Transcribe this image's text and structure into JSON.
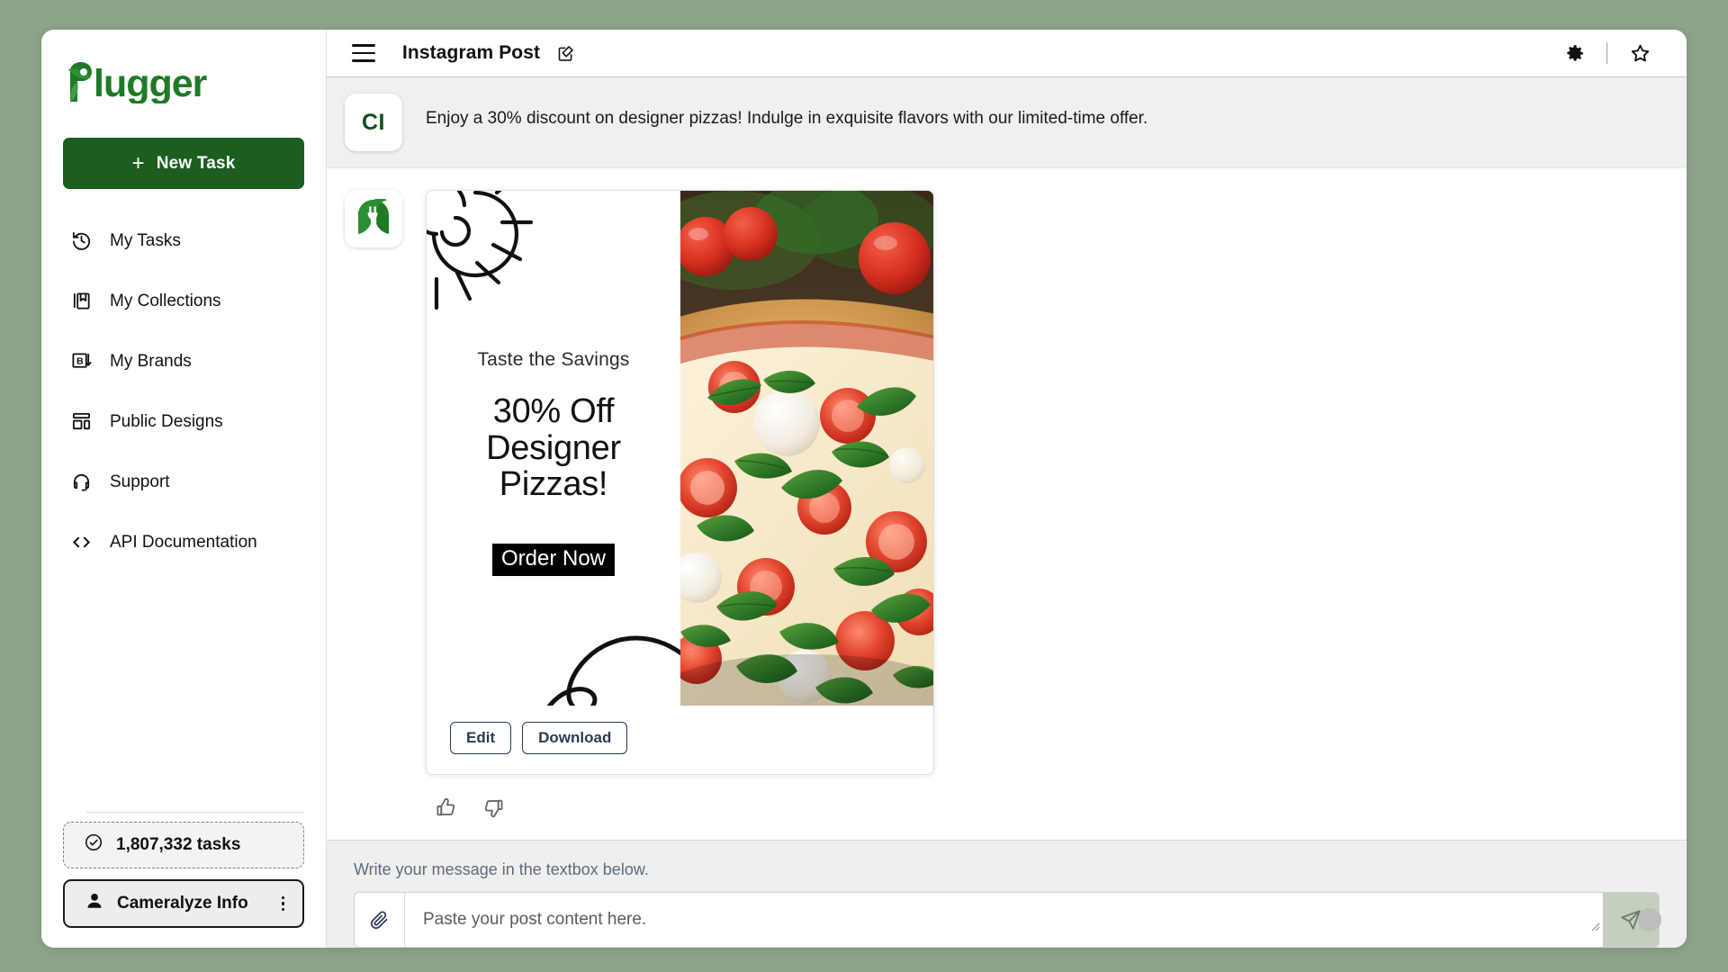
{
  "theme": {
    "page_background": "#8ba387",
    "brand_green": "#1b5e20",
    "accent_button": "#2b3a55",
    "send_button_bg": "#c3cfbf"
  },
  "sidebar": {
    "logo_text": "plugger",
    "new_task_label": "New Task",
    "new_task_plus": "+",
    "items": [
      {
        "label": "My Tasks",
        "icon": "history-icon"
      },
      {
        "label": "My Collections",
        "icon": "collections-icon"
      },
      {
        "label": "My Brands",
        "icon": "brand-box-icon"
      },
      {
        "label": "Public Designs",
        "icon": "layout-grid-icon"
      },
      {
        "label": "Support",
        "icon": "headset-icon"
      },
      {
        "label": "API Documentation",
        "icon": "code-brackets-icon"
      }
    ],
    "footer": {
      "tasks_count_label": "1,807,332 tasks",
      "account_name": "Cameralyze Info"
    }
  },
  "topbar": {
    "title": "Instagram Post",
    "menu_icon": "hamburger-icon",
    "edit_icon": "edit-square-icon",
    "settings_icon": "gear-icon",
    "favorite_icon": "star-outline-icon"
  },
  "conversation": {
    "user_message": {
      "avatar_initials": "CI",
      "text": "Enjoy a 30% discount on designer pizzas! Indulge in exquisite flavors with our limited-time offer."
    },
    "assistant_message": {
      "avatar_icon": "plugger-logo-mark",
      "design": {
        "kicker": "Taste the Savings",
        "headline_lines": [
          "30% Off",
          "Designer",
          "Pizzas!"
        ],
        "cta_label": "Order Now",
        "photo_description": "margherita pizza with cherry tomatoes, basil and mozzarella"
      },
      "actions": [
        {
          "label": "Edit"
        },
        {
          "label": "Download"
        }
      ],
      "feedback": [
        {
          "icon": "thumbs-up-icon"
        },
        {
          "icon": "thumbs-down-icon"
        }
      ]
    }
  },
  "composer": {
    "hint": "Write your message in the textbox below.",
    "placeholder": "Paste your post content here.",
    "value": "",
    "attach_icon": "paperclip-icon",
    "send_icon": "send-plane-icon"
  }
}
